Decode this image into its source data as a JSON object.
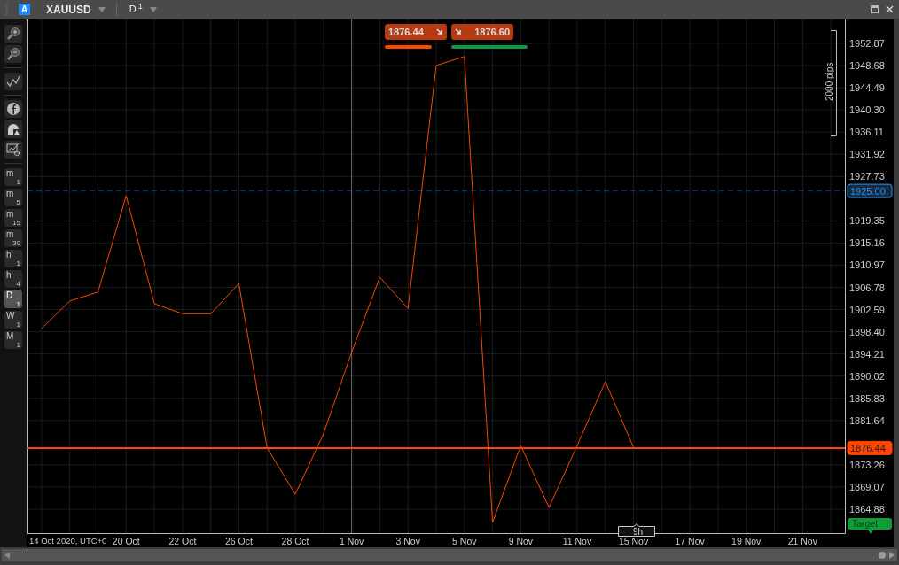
{
  "toolbar": {
    "account_badge": "A",
    "symbol": "XAUUSD",
    "timeframe": {
      "letter": "D",
      "sub": "1"
    }
  },
  "tools": [
    {
      "kind": "zoom-in"
    },
    {
      "kind": "zoom-out"
    },
    {
      "kind": "line-chart"
    },
    {
      "kind": "circle-logo"
    },
    {
      "kind": "shapes"
    },
    {
      "kind": "chart-settings"
    }
  ],
  "timeframes": [
    {
      "letter": "m",
      "sub": "1",
      "selected": false
    },
    {
      "letter": "m",
      "sub": "5",
      "selected": false
    },
    {
      "letter": "m",
      "sub": "15",
      "selected": false
    },
    {
      "letter": "m",
      "sub": "30",
      "selected": false
    },
    {
      "letter": "h",
      "sub": "1",
      "selected": false
    },
    {
      "letter": "h",
      "sub": "4",
      "selected": false
    },
    {
      "letter": "D",
      "sub": "1",
      "selected": true
    },
    {
      "letter": "W",
      "sub": "1",
      "selected": false
    },
    {
      "letter": "M",
      "sub": "1",
      "selected": false
    }
  ],
  "quotes": [
    {
      "kind": "sell",
      "price": "1876.44",
      "color": "#ff4500"
    },
    {
      "kind": "buy",
      "price": "1876.60",
      "color": "#0a9a4a"
    }
  ],
  "ruler": {
    "label": "2000 pips"
  },
  "time_marker": {
    "label": "9h"
  },
  "chart": {
    "chart_data": {
      "type": "line",
      "categories": [
        null,
        null,
        null,
        "20 Oct",
        null,
        "22 Oct",
        null,
        "26 Oct",
        null,
        "28 Oct",
        null,
        "1 Nov",
        null,
        "3 Nov",
        null,
        "5 Nov",
        null,
        "9 Nov",
        null,
        "11 Nov",
        null,
        "15 Nov",
        null,
        "17 Nov",
        null,
        "19 Nov",
        null,
        "21 Nov",
        null
      ],
      "series": [
        {
          "color": "#ff4500",
          "values": [
            1899.0,
            1904.2,
            1905.9,
            1924.1,
            1903.7,
            1901.8,
            1901.8,
            1907.5,
            1876.5,
            1867.7,
            1879.1,
            1894.5,
            1908.7,
            1902.8,
            1948.7,
            1950.4,
            1862.4,
            1876.9,
            1865.2,
            1876.9,
            1889.0,
            1876.5,
            null,
            null,
            null,
            null,
            null,
            null,
            null
          ]
        }
      ],
      "ylim": [
        1860.36,
        1957.39
      ],
      "grid": true,
      "ref_lines": [
        {
          "axis": "y",
          "value": 1925.0,
          "label": "1925.00",
          "color": "#1e90ff"
        },
        {
          "axis": "y",
          "value": 1876.44,
          "label": "1876.44",
          "color": "#ff4500"
        }
      ],
      "yticks": [
        {
          "value": 1952.87,
          "label": "1952.87"
        },
        {
          "value": 1948.68,
          "label": "1948.68"
        },
        {
          "value": 1944.49,
          "label": "1944.49"
        },
        {
          "value": 1940.3,
          "label": "1940.30"
        },
        {
          "value": 1936.11,
          "label": "1936.11"
        },
        {
          "value": 1931.92,
          "label": "1931.92"
        },
        {
          "value": 1927.73,
          "label": "1927.73"
        },
        {
          "value": 1919.35,
          "label": "1919.35"
        },
        {
          "value": 1915.16,
          "label": "1915.16"
        },
        {
          "value": 1910.97,
          "label": "1910.97"
        },
        {
          "value": 1906.78,
          "label": "1906.78"
        },
        {
          "value": 1902.59,
          "label": "1902.59"
        },
        {
          "value": 1898.4,
          "label": "1898.40"
        },
        {
          "value": 1894.21,
          "label": "1894.21"
        },
        {
          "value": 1890.02,
          "label": "1890.02"
        },
        {
          "value": 1885.83,
          "label": "1885.83"
        },
        {
          "value": 1881.64,
          "label": "1881.64"
        },
        {
          "value": 1873.26,
          "label": "1873.26"
        },
        {
          "value": 1869.07,
          "label": "1869.07"
        },
        {
          "value": 1864.88,
          "label": "1864.88"
        }
      ]
    },
    "axis_start_label": "14 Oct 2020, UTC+0",
    "target": {
      "label": "Target"
    }
  }
}
